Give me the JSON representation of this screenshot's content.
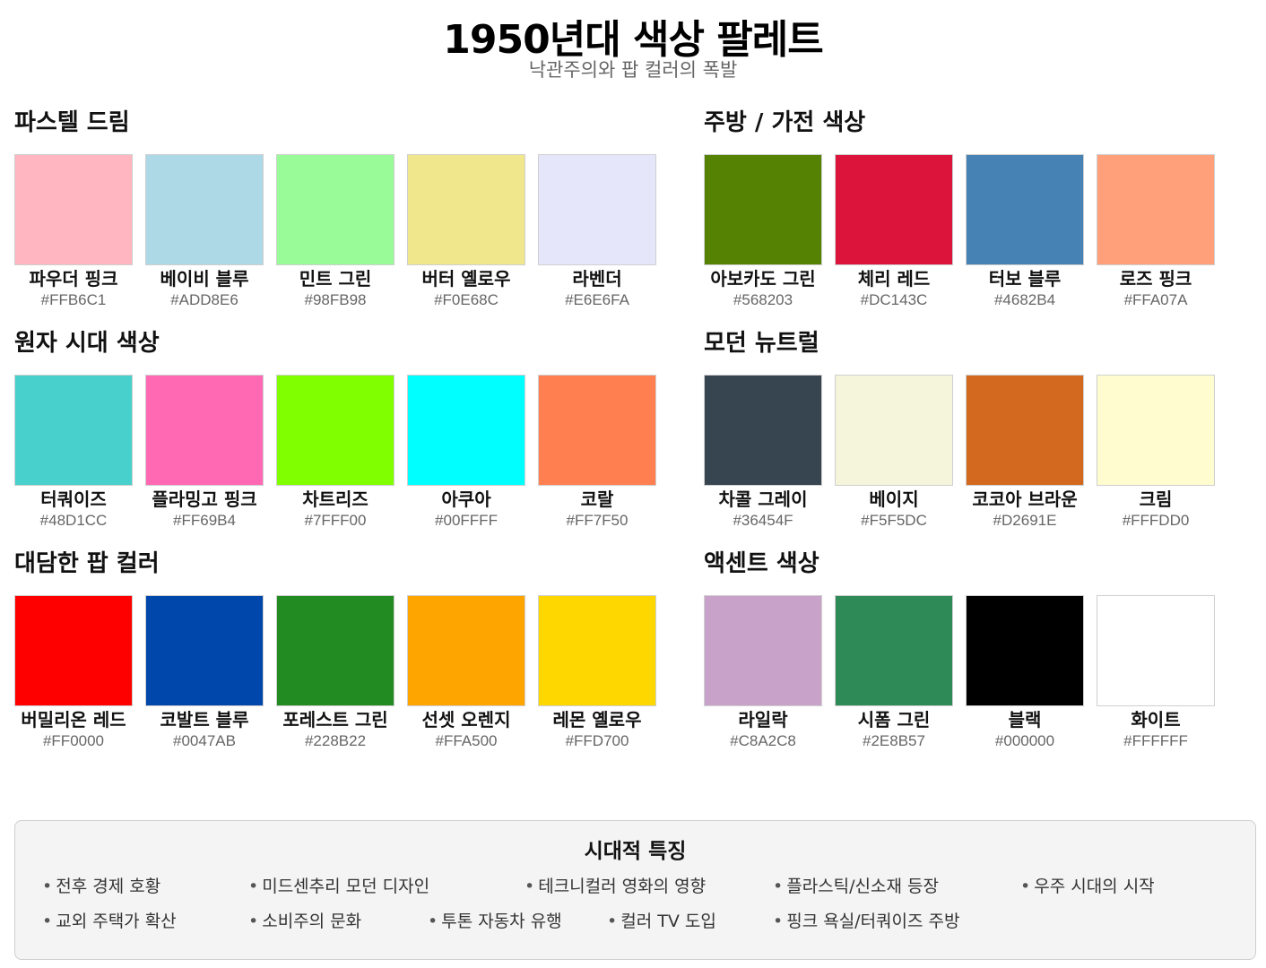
{
  "header": {
    "title": "1950년대 색상 팔레트",
    "subtitle": "낙관주의와 팝 컬러의 폭발"
  },
  "sections": [
    {
      "title": "파스텔 드림",
      "colors": [
        {
          "name": "파우더 핑크",
          "hex": "#FFB6C1"
        },
        {
          "name": "베이비 블루",
          "hex": "#ADD8E6"
        },
        {
          "name": "민트 그린",
          "hex": "#98FB98"
        },
        {
          "name": "버터 옐로우",
          "hex": "#F0E68C"
        },
        {
          "name": "라벤더",
          "hex": "#E6E6FA"
        }
      ]
    },
    {
      "title": "주방 / 가전 색상",
      "colors": [
        {
          "name": "아보카도 그린",
          "hex": "#568203"
        },
        {
          "name": "체리 레드",
          "hex": "#DC143C"
        },
        {
          "name": "터보 블루",
          "hex": "#4682B4"
        },
        {
          "name": "로즈 핑크",
          "hex": "#FFA07A"
        }
      ]
    },
    {
      "title": "원자 시대 색상",
      "colors": [
        {
          "name": "터쿼이즈",
          "hex": "#48D1CC"
        },
        {
          "name": "플라밍고 핑크",
          "hex": "#FF69B4"
        },
        {
          "name": "차트리즈",
          "hex": "#7FFF00"
        },
        {
          "name": "아쿠아",
          "hex": "#00FFFF"
        },
        {
          "name": "코랄",
          "hex": "#FF7F50"
        }
      ]
    },
    {
      "title": "모던 뉴트럴",
      "colors": [
        {
          "name": "차콜 그레이",
          "hex": "#36454F"
        },
        {
          "name": "베이지",
          "hex": "#F5F5DC"
        },
        {
          "name": "코코아 브라운",
          "hex": "#D2691E"
        },
        {
          "name": "크림",
          "hex": "#FFFDD0"
        }
      ]
    },
    {
      "title": "대담한 팝 컬러",
      "colors": [
        {
          "name": "버밀리온 레드",
          "hex": "#FF0000"
        },
        {
          "name": "코발트 블루",
          "hex": "#0047AB"
        },
        {
          "name": "포레스트 그린",
          "hex": "#228B22"
        },
        {
          "name": "선셋 오렌지",
          "hex": "#FFA500"
        },
        {
          "name": "레몬 옐로우",
          "hex": "#FFD700"
        }
      ]
    },
    {
      "title": "액센트 색상",
      "colors": [
        {
          "name": "라일락",
          "hex": "#C8A2C8"
        },
        {
          "name": "시폼 그린",
          "hex": "#2E8B57"
        },
        {
          "name": "블랙",
          "hex": "#000000"
        },
        {
          "name": "화이트",
          "hex": "#FFFFFF"
        }
      ]
    }
  ],
  "features": {
    "title": "시대적 특징",
    "items": [
      "전후 경제 호황",
      "미드센추리 모던 디자인",
      "테크니컬러 영화의 영향",
      "플라스틱/신소재 등장",
      "우주 시대의 시작",
      "교외 주택가 확산",
      "소비주의 문화",
      "투톤 자동차 유행",
      "컬러 TV 도입",
      "핑크 욕실/터쿼이즈 주방"
    ]
  }
}
